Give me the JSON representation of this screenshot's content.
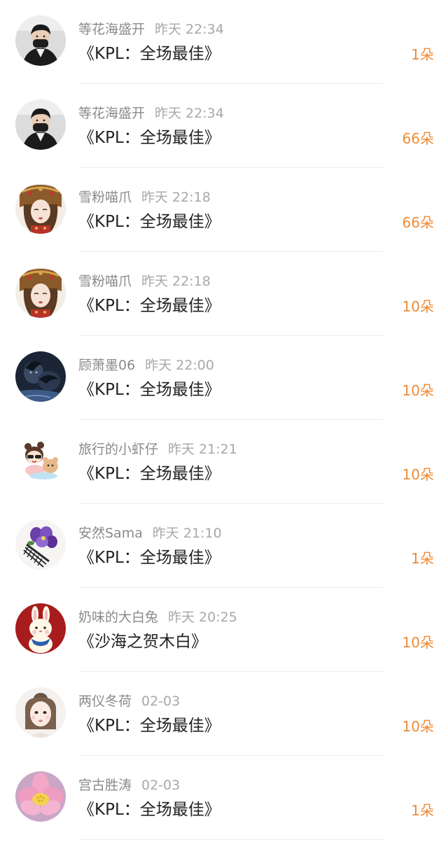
{
  "colors": {
    "background": "#ffffff",
    "name_text": "#8a8a8a",
    "time_text": "#a8a8a8",
    "gift_text": "#222222",
    "count_accent": "#f08a35",
    "divider": "#ededed"
  },
  "records": [
    {
      "name": "等花海盛开",
      "time": "昨天 22:34",
      "gift": "《KPL：全场最佳》",
      "count": "1朵",
      "avatar": "avatar-man-black-mask"
    },
    {
      "name": "等花海盛开",
      "time": "昨天 22:34",
      "gift": "《KPL：全场最佳》",
      "count": "66朵",
      "avatar": "avatar-man-black-mask"
    },
    {
      "name": "雪粉喵爪",
      "time": "昨天 22:18",
      "gift": "《KPL：全场最佳》",
      "count": "66朵",
      "avatar": "avatar-girl-traditional-headdress"
    },
    {
      "name": "雪粉喵爪",
      "time": "昨天 22:18",
      "gift": "《KPL：全场最佳》",
      "count": "10朵",
      "avatar": "avatar-girl-traditional-headdress"
    },
    {
      "name": "顾萧墨06",
      "time": "昨天 22:00",
      "gift": "《KPL：全场最佳》",
      "count": "10朵",
      "avatar": "avatar-dark-figures"
    },
    {
      "name": "旅行的小虾仔",
      "time": "昨天 21:21",
      "gift": "《KPL：全场最佳》",
      "count": "10朵",
      "avatar": "avatar-cartoon-girl-with-bear"
    },
    {
      "name": "安然Sama",
      "time": "昨天 21:10",
      "gift": "《KPL：全场最佳》",
      "count": "1朵",
      "avatar": "avatar-purple-flower-comb"
    },
    {
      "name": "奶味的大白兔",
      "time": "昨天 20:25",
      "gift": "《沙海之贺木白》",
      "count": "10朵",
      "avatar": "avatar-white-rabbit-red"
    },
    {
      "name": "两仪冬荷",
      "time": "02-03",
      "gift": "《KPL：全场最佳》",
      "count": "10朵",
      "avatar": "avatar-girl-portrait"
    },
    {
      "name": "宫古胜涛",
      "time": "02-03",
      "gift": "《KPL：全场最佳》",
      "count": "1朵",
      "avatar": "avatar-pink-lotus"
    }
  ]
}
